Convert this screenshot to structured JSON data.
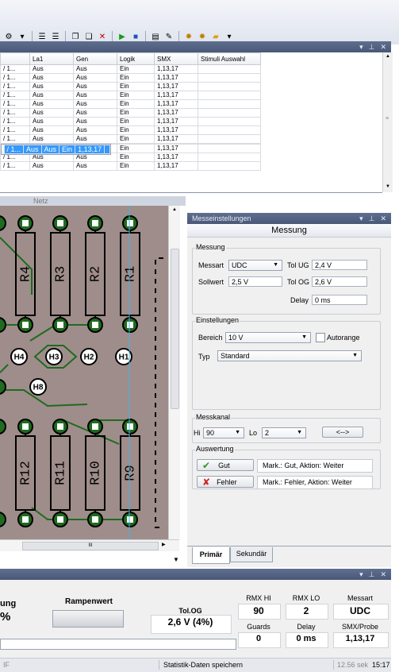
{
  "toolbar": {
    "icons": [
      "settings-icon",
      "dropdown-icon",
      "list-collapse-icon",
      "list-expand-icon",
      "copy-icon",
      "paste-icon",
      "delete-icon",
      "play-icon",
      "stop-icon",
      "save-icon",
      "tools-icon",
      "gear-icon",
      "gears-icon",
      "folder-icon",
      "dropdown-icon"
    ]
  },
  "table": {
    "columns": [
      "La1",
      "Gen",
      "Logik",
      "SMX",
      "Stimuli Auswahl"
    ],
    "rows": [
      [
        "/ 1...",
        "Aus",
        "Aus",
        "Ein",
        "1,13,17",
        ""
      ],
      [
        "/ 1...",
        "Aus",
        "Aus",
        "Ein",
        "1,13,17",
        ""
      ],
      [
        "/ 1...",
        "Aus",
        "Aus",
        "Ein",
        "1,13,17",
        ""
      ],
      [
        "/ 1...",
        "Aus",
        "Aus",
        "Ein",
        "1,13,17",
        ""
      ],
      [
        "/ 1...",
        "Aus",
        "Aus",
        "Ein",
        "1,13,17",
        ""
      ],
      [
        "/ 1...",
        "Aus",
        "Aus",
        "Ein",
        "1,13,17",
        ""
      ],
      [
        "/ 1...",
        "Aus",
        "Aus",
        "Ein",
        "1,13,17",
        ""
      ],
      [
        "/ 1...",
        "Aus",
        "Aus",
        "Ein",
        "1,13,17",
        ""
      ],
      [
        "/ 1...",
        "Aus",
        "Aus",
        "Ein",
        "1,13,17",
        ""
      ],
      [
        "/ 1...",
        "Aus",
        "Aus",
        "Ein",
        "1,13,17",
        ""
      ],
      [
        "/ 1...",
        "Aus",
        "Aus",
        "Ein",
        "1,13,17",
        ""
      ],
      [
        "/ 1...",
        "Aus",
        "Aus",
        "Ein",
        "1,13,17",
        ""
      ],
      [
        "/ 1...",
        "Aus",
        "Aus",
        "Ein",
        "1,13,17",
        ""
      ]
    ],
    "selected_row": 9,
    "selected_color": "#3399ff"
  },
  "pcb": {
    "tab_label": "Netz",
    "resistors_top": [
      "R4",
      "R3",
      "R2",
      "R1"
    ],
    "resistors_bottom": [
      "R12",
      "R11",
      "R10",
      "R9"
    ],
    "pad_labels": [
      "H4",
      "H3",
      "H2",
      "H1",
      "H8"
    ],
    "board_color": "#9e8d8a",
    "trace_color": "#1f6b1f",
    "hscroll_label": "III"
  },
  "settings": {
    "dock_title": "Messeinstellungen",
    "header": "Messung",
    "messung": {
      "group_label": "Messung",
      "messart_label": "Messart",
      "messart_value": "UDC",
      "tolug_label": "Tol UG",
      "tolug_value": "2,4 V",
      "sollwert_label": "Sollwert",
      "sollwert_value": "2,5 V",
      "tolog_label": "Tol OG",
      "tolog_value": "2,6 V",
      "delay_label": "Delay",
      "delay_value": "0 ms"
    },
    "einstellungen": {
      "group_label": "Einstellungen",
      "bereich_label": "Bereich",
      "bereich_value": "10 V",
      "autorange_label": "Autorange",
      "typ_label": "Typ",
      "typ_value": "Standard"
    },
    "messkanal": {
      "group_label": "Messkanal",
      "hi_label": "Hi",
      "hi_value": "90",
      "lo_label": "Lo",
      "lo_value": "2",
      "swap_label": "<-->"
    },
    "auswertung": {
      "group_label": "Auswertung",
      "gut_label": "Gut",
      "gut_text": "Mark.: Gut, Aktion: Weiter",
      "fehler_label": "Fehler",
      "fehler_text": "Mark.: Fehler, Aktion: Weiter"
    },
    "tabs": [
      "Primär",
      "Sekundär"
    ]
  },
  "bottom": {
    "partial_label": "ung",
    "partial_value": "%",
    "rampenwert_label": "Rampenwert",
    "tolog_label": "Tol.OG",
    "tolog_value": "2,6 V (4%)",
    "rmxhi_label": "RMX HI",
    "rmxhi_value": "90",
    "rmxlo_label": "RMX LO",
    "rmxlo_value": "2",
    "messart_label": "Messart",
    "messart_value": "UDC",
    "guards_label": "Guards",
    "guards_value": "0",
    "delay_label": "Delay",
    "delay_value": "0 ms",
    "smx_label": "SMX/Probe",
    "smx_value": "1,13,17"
  },
  "status": {
    "left": "IF",
    "center": "Statistik-Daten speichern",
    "time1": "12.56 sek",
    "time2": "15:17"
  }
}
